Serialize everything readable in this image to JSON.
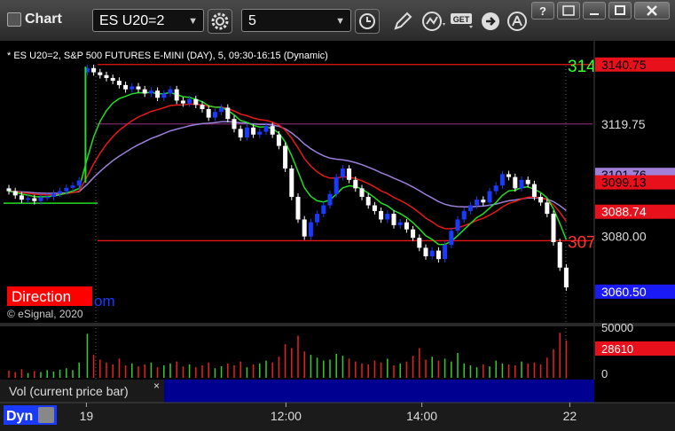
{
  "window": {
    "title": "Chart",
    "symbol": "ES U20=2",
    "interval": "5",
    "get_label": "GET"
  },
  "chart_data": {
    "type": "candlestick",
    "header": "* ES U20=2, S&P 500 FUTURES E-MINI (DAY), 5, 09:30-16:15 (Dynamic)",
    "ylim": [
      3052,
      3146
    ],
    "price_ticks": [
      "3119.75",
      "3080.00"
    ],
    "price_labels": [
      {
        "text": "3140.75",
        "price": 3140.75,
        "bg": "#e8101a",
        "color": "#000000"
      },
      {
        "text": "3101.76",
        "price": 3101.76,
        "bg": "#a080d8",
        "color": "#000000"
      },
      {
        "text": "3099.13",
        "price": 3099.13,
        "bg": "#e8101a",
        "color": "#000000"
      },
      {
        "text": "3088.74",
        "price": 3088.74,
        "bg": "#e8101a",
        "color": "#ffffff"
      },
      {
        "text": "3060.50",
        "price": 3060.5,
        "bg": "#1a1af5",
        "color": "#ffffff"
      }
    ],
    "hlines": [
      {
        "price": 3140.75,
        "color": "#e81818",
        "text": "314",
        "text_color": "#33ff33"
      },
      {
        "price": 3119.75,
        "color": "#7a2a6a",
        "text": "",
        "text_color": ""
      },
      {
        "price": 3078.5,
        "color": "#e81818",
        "text": "307",
        "text_color": "#ff3333"
      }
    ],
    "prev_close": 3088.0,
    "candles": [
      3096.0,
      3094.5,
      3093.0,
      3093.5,
      3092.5,
      3093.8,
      3094.0,
      3095.2,
      3096.0,
      3097.2,
      3098.0,
      3099.8,
      3139.5,
      3138.0,
      3137.0,
      3136.0,
      3135.0,
      3133.5,
      3132.0,
      3133.0,
      3132.0,
      3130.5,
      3131.5,
      3129.0,
      3130.5,
      3132.0,
      3128.0,
      3127.0,
      3128.5,
      3126.5,
      3125.0,
      3122.0,
      3124.0,
      3125.5,
      3121.5,
      3118.0,
      3115.0,
      3118.5,
      3116.0,
      3117.0,
      3119.0,
      3116.0,
      3112.0,
      3104.0,
      3094.0,
      3086.0,
      3080.0,
      3085.0,
      3088.0,
      3091.0,
      3095.0,
      3101.0,
      3104.0,
      3100.0,
      3097.0,
      3094.0,
      3091.0,
      3089.0,
      3086.0,
      3088.0,
      3084.0,
      3085.0,
      3082.5,
      3079.5,
      3076.0,
      3073.0,
      3075.0,
      3072.0,
      3077.0,
      3082.0,
      3086.0,
      3089.0,
      3091.0,
      3093.0,
      3092.0,
      3096.0,
      3098.0,
      3102.0,
      3101.0,
      3097.0,
      3100.0,
      3098.5,
      3094.0,
      3092.0,
      3088.0,
      3078.0,
      3069.0,
      3062.0
    ],
    "volumes": [
      0.15,
      0.12,
      0.18,
      0.1,
      0.14,
      0.12,
      0.16,
      0.13,
      0.17,
      0.2,
      0.16,
      0.32,
      0.92,
      0.48,
      0.38,
      0.32,
      0.28,
      0.4,
      0.26,
      0.3,
      0.24,
      0.28,
      0.32,
      0.22,
      0.26,
      0.3,
      0.34,
      0.24,
      0.28,
      0.22,
      0.26,
      0.32,
      0.2,
      0.24,
      0.3,
      0.26,
      0.34,
      0.22,
      0.28,
      0.3,
      0.36,
      0.32,
      0.44,
      0.7,
      0.62,
      0.88,
      0.55,
      0.48,
      0.42,
      0.36,
      0.38,
      0.5,
      0.46,
      0.4,
      0.34,
      0.3,
      0.28,
      0.36,
      0.32,
      0.4,
      0.26,
      0.3,
      0.34,
      0.46,
      0.62,
      0.38,
      0.44,
      0.36,
      0.4,
      0.34,
      0.52,
      0.3,
      0.26,
      0.22,
      0.28,
      0.24,
      0.36,
      0.3,
      0.28,
      0.26,
      0.34,
      0.3,
      0.32,
      0.28,
      0.42,
      0.6,
      0.94,
      0.78
    ],
    "volume_ylim": [
      0,
      52000
    ],
    "volume_ticks": [
      "50000",
      "0"
    ],
    "volume_last": "28610",
    "indicator_label": "Vol (current price bar)",
    "x_labels": [
      "19",
      "12:00",
      "14:00",
      "22"
    ],
    "direction_label": "Direction",
    "watermark": "© eSignal, 2020",
    "dyn_label": "Dyn",
    "colors": {
      "up": "#1a3aff",
      "down": "#ffffff",
      "ema_red": "#e81818",
      "ema_green": "#22dd22",
      "vwap_purple": "#9a80d8",
      "volume_up": "#33cc33",
      "volume_down": "#e82020",
      "indicator_bar": "#000090"
    }
  }
}
